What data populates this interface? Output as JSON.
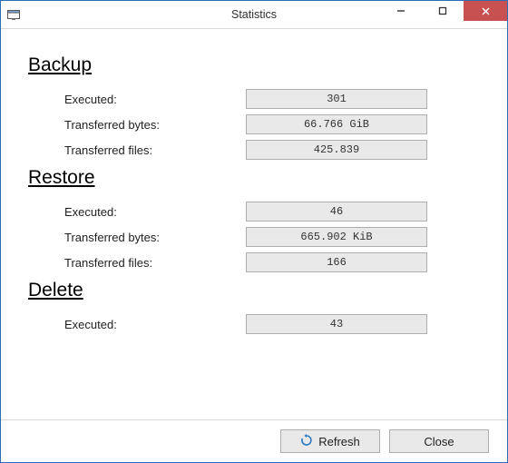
{
  "window": {
    "title": "Statistics"
  },
  "sections": {
    "backup": {
      "title": "Backup",
      "executed_label": "Executed:",
      "executed_value": "301",
      "bytes_label": "Transferred bytes:",
      "bytes_value": "66.766 GiB",
      "files_label": "Transferred files:",
      "files_value": "425.839"
    },
    "restore": {
      "title": "Restore",
      "executed_label": "Executed:",
      "executed_value": "46",
      "bytes_label": "Transferred bytes:",
      "bytes_value": "665.902 KiB",
      "files_label": "Transferred files:",
      "files_value": "166"
    },
    "delete": {
      "title": "Delete",
      "executed_label": "Executed:",
      "executed_value": "43"
    }
  },
  "buttons": {
    "refresh": "Refresh",
    "close": "Close"
  }
}
